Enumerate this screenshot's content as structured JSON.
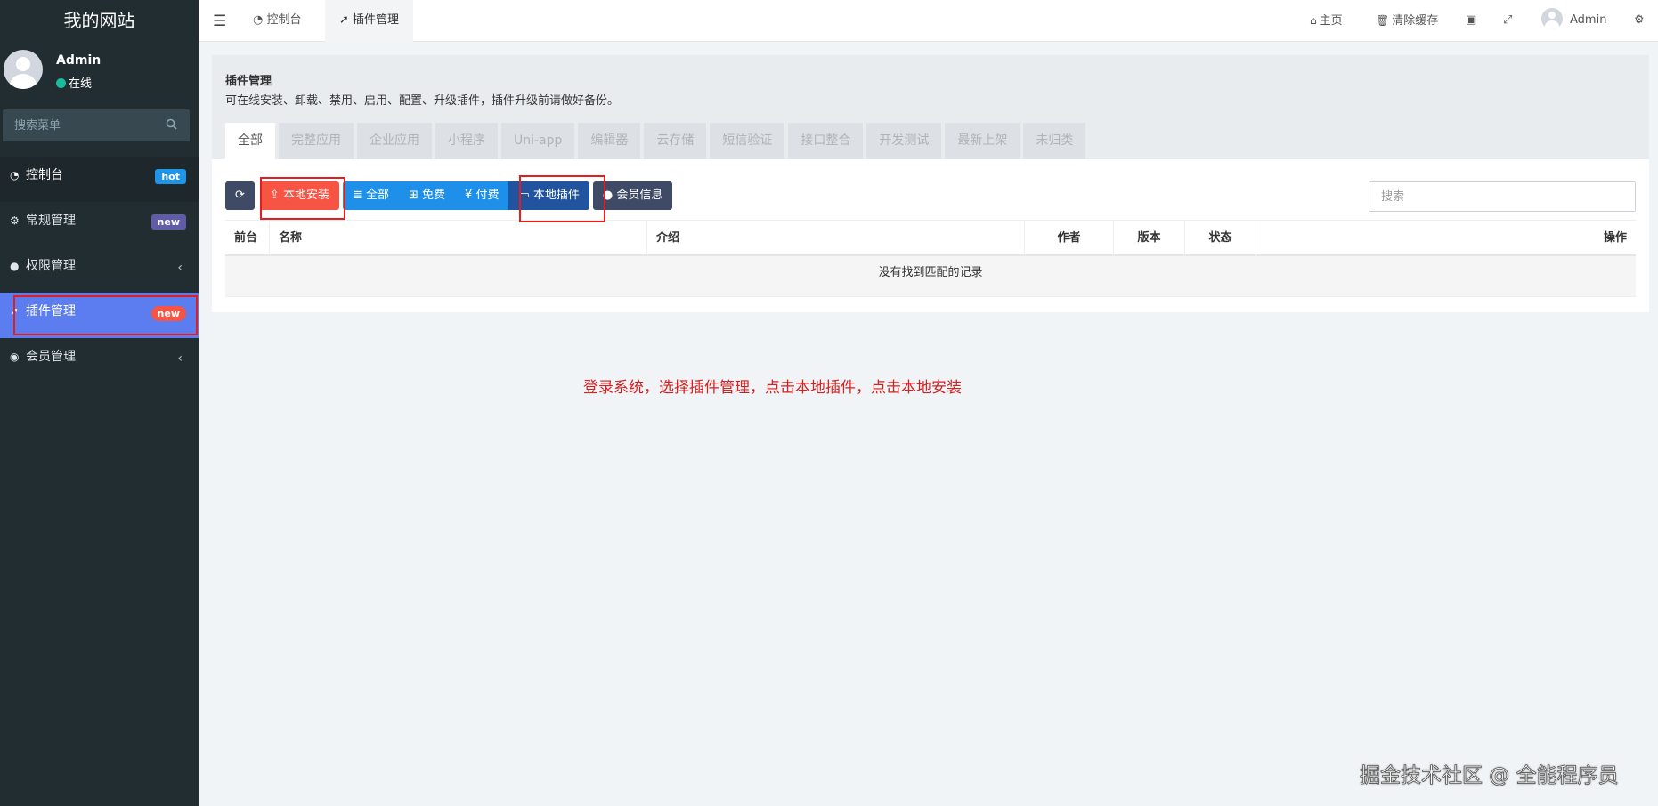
{
  "sidebar": {
    "logo": "我的网站",
    "user": {
      "name": "Admin",
      "status": "在线"
    },
    "search_placeholder": "搜索菜单",
    "items": [
      {
        "label": "控制台",
        "badge": "hot",
        "icon": "dashboard-icon"
      },
      {
        "label": "常规管理",
        "badge": "new",
        "icon": "cogs-icon"
      },
      {
        "label": "权限管理",
        "icon": "users-icon",
        "chevron": "‹"
      },
      {
        "label": "插件管理",
        "badge": "new",
        "icon": "rocket-icon"
      },
      {
        "label": "会员管理",
        "icon": "user-circle-icon",
        "chevron": "‹"
      }
    ]
  },
  "header": {
    "tabs": [
      {
        "label": "控制台",
        "icon": "dashboard-icon"
      },
      {
        "label": "插件管理",
        "icon": "rocket-icon"
      }
    ],
    "home": "主页",
    "clear_cache": "清除缓存",
    "user": "Admin"
  },
  "panel": {
    "title": "插件管理",
    "description": "可在线安装、卸载、禁用、启用、配置、升级插件，插件升级前请做好备份。",
    "categories": [
      "全部",
      "完整应用",
      "企业应用",
      "小程序",
      "Uni-app",
      "编辑器",
      "云存储",
      "短信验证",
      "接口整合",
      "开发测试",
      "最新上架",
      "未归类"
    ],
    "toolbar": {
      "local_install": "本地安装",
      "all": "全部",
      "free": "免费",
      "paid": "付费",
      "local_plugins": "本地插件",
      "member_info": "会员信息"
    },
    "search_placeholder": "搜索",
    "table": {
      "columns": [
        "前台",
        "名称",
        "介绍",
        "作者",
        "版本",
        "状态",
        "操作"
      ],
      "empty_text": "没有找到匹配的记录"
    }
  },
  "annotation": "登录系统，选择插件管理，点击本地插件，点击本地安装",
  "watermark": "掘金技术社区 @ 全能程序员",
  "colors": {
    "sidebar_bg": "#222d32",
    "selected_menu": "#5b7df0",
    "btn_red": "#f75444",
    "btn_blue": "#1e90e9",
    "btn_navy": "#21539e",
    "annotation_red": "#d82020"
  }
}
